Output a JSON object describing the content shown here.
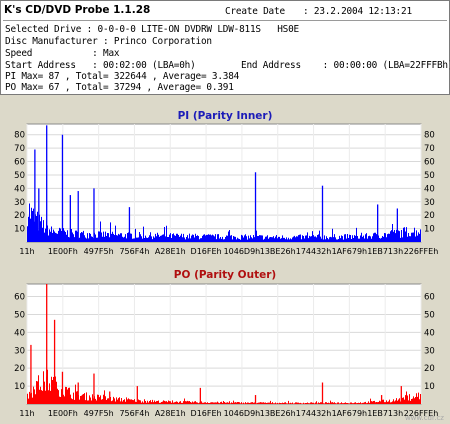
{
  "app": {
    "title": "K's CD/DVD Probe 1.1.28"
  },
  "info": {
    "create_date_label": "Create Date",
    "create_date_value": ": 23.2.2004 12:13:21",
    "selected_drive": "Selected Drive : 0-0-0-0 LITE-ON DVDRW LDW-811S   HS0E",
    "disc_manufacturer": "Disc Manufacturer : Princo Corporation",
    "speed": "Speed           : Max",
    "start_address": "Start Address   : 00:02:00 (LBA=0h)",
    "end_address": "End Address    : 00:00:00 (LBA=22FFFBh)",
    "pi_stats": "PI Max= 87 , Total= 322644 , Average= 3.384",
    "po_stats": "PO Max= 67 , Total= 37294 , Average= 0.391"
  },
  "x_ticks": [
    "11h",
    "1E00Fh",
    "497F5h",
    "756F4h",
    "A28E1h",
    "D16FEh",
    "1046D9h",
    "13BE26h",
    "174432h",
    "1AF679h",
    "1EB713h",
    "226FFEh"
  ],
  "chart_data": [
    {
      "type": "bar",
      "title": "PI (Parity Inner)",
      "color": "#0000ff",
      "ylim": [
        0,
        88
      ],
      "yticks": [
        10,
        20,
        30,
        40,
        50,
        60,
        70,
        80
      ],
      "x_range": [
        "11h",
        "22FFFBh"
      ],
      "baseline_profile": [
        [
          0,
          26
        ],
        [
          0.01,
          20
        ],
        [
          0.03,
          14
        ],
        [
          0.06,
          8
        ],
        [
          0.12,
          6
        ],
        [
          0.25,
          5
        ],
        [
          0.45,
          4
        ],
        [
          0.65,
          3.5
        ],
        [
          0.85,
          4
        ],
        [
          0.93,
          6
        ],
        [
          0.97,
          8
        ],
        [
          1.0,
          8
        ]
      ],
      "spikes": [
        [
          0.02,
          69
        ],
        [
          0.03,
          40
        ],
        [
          0.05,
          87
        ],
        [
          0.09,
          80
        ],
        [
          0.11,
          35
        ],
        [
          0.13,
          38
        ],
        [
          0.17,
          40
        ],
        [
          0.26,
          26
        ],
        [
          0.58,
          52
        ],
        [
          0.75,
          42
        ],
        [
          0.89,
          28
        ],
        [
          0.94,
          25
        ]
      ]
    },
    {
      "type": "bar",
      "title": "PO (Parity Outer)",
      "color": "#ff0000",
      "ylim": [
        0,
        67
      ],
      "yticks": [
        10,
        20,
        30,
        40,
        50,
        60
      ],
      "x_range": [
        "11h",
        "22FFFBh"
      ],
      "baseline_profile": [
        [
          0,
          4
        ],
        [
          0.02,
          10
        ],
        [
          0.05,
          13
        ],
        [
          0.08,
          9
        ],
        [
          0.12,
          5
        ],
        [
          0.2,
          3
        ],
        [
          0.3,
          1.5
        ],
        [
          0.5,
          0.8
        ],
        [
          0.7,
          0.6
        ],
        [
          0.85,
          0.8
        ],
        [
          0.93,
          2
        ],
        [
          1.0,
          5
        ]
      ],
      "spikes": [
        [
          0.01,
          33
        ],
        [
          0.05,
          67
        ],
        [
          0.07,
          47
        ],
        [
          0.09,
          18
        ],
        [
          0.13,
          12
        ],
        [
          0.17,
          17
        ],
        [
          0.21,
          7
        ],
        [
          0.28,
          10
        ],
        [
          0.44,
          9
        ],
        [
          0.58,
          5
        ],
        [
          0.75,
          12
        ],
        [
          0.9,
          5
        ],
        [
          0.95,
          10
        ]
      ]
    }
  ],
  "watermark": "www.cdr.cz"
}
